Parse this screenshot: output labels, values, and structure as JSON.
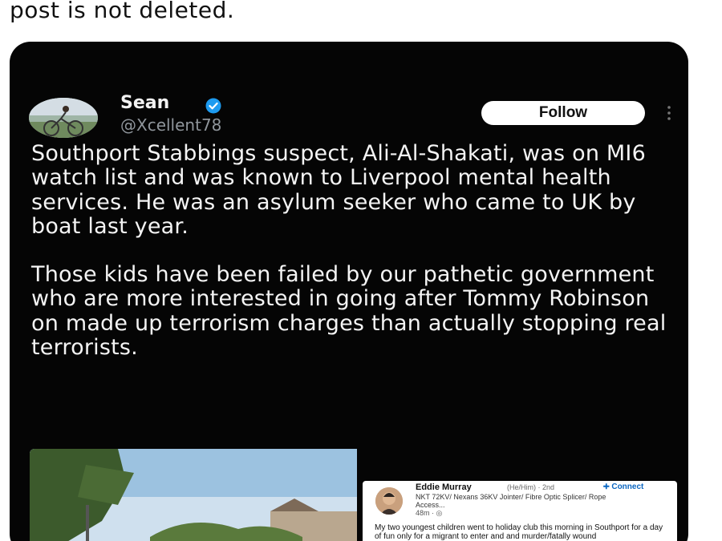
{
  "caption": "post is not deleted.",
  "tweet": {
    "display_name": "Sean",
    "handle": "@Xcellent78",
    "follow_label": "Follow",
    "paragraph_1": "Southport Stabbings suspect, Ali-Al-Shakati,  was on MI6 watch list and was known to Liverpool mental health services. He was an asylum seeker who came to UK by boat last year.",
    "paragraph_2": "Those kids have been failed by our pathetic government who are more interested in going after Tommy Robinson on made up terrorism charges than actually stopping real terrorists."
  },
  "embed": {
    "name": "Eddie Murray",
    "meta": "(He/Him) · 2nd",
    "connect_label": "Connect",
    "headline": "NKT 72KV/ Nexans 36KV Jointer/ Fibre Optic Splicer/ Rope Access...",
    "time": "48m · ",
    "body": "My two youngest children went to holiday club this morning in Southport  for a day of fun only for a migrant to enter and and murder/fatally wound"
  },
  "colors": {
    "card_background": "#050505",
    "verified_badge": "#1d9bf0",
    "connect_blue": "#0a66c2"
  },
  "icons": {
    "verified": "verified-badge-icon",
    "more": "more-vertical-icon",
    "connect": "user-plus-icon",
    "globe": "globe-icon"
  }
}
